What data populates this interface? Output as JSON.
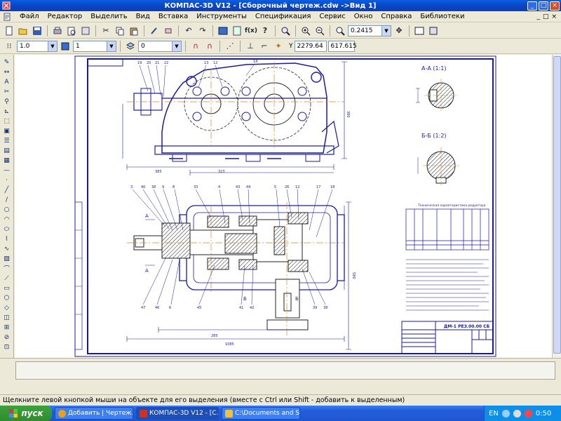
{
  "window": {
    "title": "КОМПАС-3D V12 - [Сборочный чертеж.cdw ->Вид 1]",
    "buttons": {
      "minimize": "_",
      "maximize": "□",
      "close": "×"
    }
  },
  "menubar": {
    "items": [
      "Файл",
      "Редактор",
      "Выделить",
      "Вид",
      "Вставка",
      "Инструменты",
      "Спецификация",
      "Сервис",
      "Окно",
      "Справка",
      "Библиотеки"
    ],
    "mdi": [
      "_",
      "□",
      "×"
    ]
  },
  "toolbar1": {
    "zoom_value": "0.2415"
  },
  "toolbar2": {
    "style_value": "1.0",
    "layer_value": "1",
    "state_value": "0",
    "coord_x": "2279.64",
    "coord_y": "617.615",
    "y_label": "Y"
  },
  "drawing": {
    "stamp_number": "ДМ-1 РЕЗ.00.00 СБ",
    "section_aa": "А-А (1:1)",
    "section_bb": "Б-Б (1:2)",
    "table_title": "Техническая характеристика редуктора",
    "mark_a": "А",
    "mark_b": "Б",
    "mark_g": "В"
  },
  "statusbar": {
    "text": "Щелкните левой кнопкой мыши на объекте для его выделения (вместе с Ctrl или Shift - добавить к выделенным)"
  },
  "taskbar": {
    "start_label": "пуск",
    "tasks": [
      {
        "label": "Добавить | Чертеж...",
        "color": "#e8a020"
      },
      {
        "label": "КОМПАС-3D V12 - [С...",
        "color": "#d43020"
      },
      {
        "label": "C:\\Documents and Se...",
        "color": "#f0c040"
      }
    ],
    "lang": "EN",
    "clock": "0:50"
  }
}
